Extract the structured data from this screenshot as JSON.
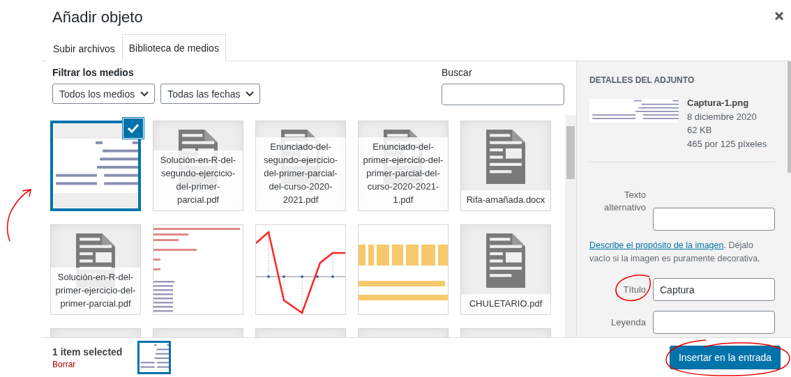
{
  "modal": {
    "title": "Añadir objeto"
  },
  "tabs": [
    {
      "label": "Subir archivos",
      "selected": false
    },
    {
      "label": "Biblioteca de medios",
      "selected": true
    }
  ],
  "filters": {
    "heading": "Filtrar los medios",
    "type_select": "Todos los medios",
    "date_select": "Todas las fechas"
  },
  "search": {
    "label": "Buscar"
  },
  "media": [
    {
      "kind": "table-image",
      "selected": true
    },
    {
      "kind": "document",
      "name": "Solución-en-R-del-segundo-ejercicio-del-primer-parcial.pdf",
      "selected": false
    },
    {
      "kind": "document",
      "name": "Enunciado-del-segundo-ejercicio-del-primer-parcial-del-curso-2020-2021.pdf",
      "selected": false
    },
    {
      "kind": "document",
      "name": "Enunciado-del-primer-ejercicio-del-primer-parcial-del-curso-2020-2021-1.pdf",
      "selected": false
    },
    {
      "kind": "document",
      "name": "Rifa-amañada.docx",
      "selected": false
    },
    {
      "kind": "document",
      "name": "Solución-en-R-del-primer-ejercicio-del-primer-parcial.pdf",
      "selected": false
    },
    {
      "kind": "code-image",
      "selected": false
    },
    {
      "kind": "graph-image",
      "selected": false
    },
    {
      "kind": "banner-image",
      "selected": false
    },
    {
      "kind": "document",
      "name": "CHULETARIO.pdf",
      "selected": false
    },
    {
      "kind": "blank",
      "selected": false
    },
    {
      "kind": "blank",
      "selected": false
    },
    {
      "kind": "blank",
      "selected": false
    },
    {
      "kind": "blank",
      "selected": false
    },
    {
      "kind": "blank",
      "selected": false
    }
  ],
  "details": {
    "heading": "DETALLES DEL ADJUNTO",
    "filename": "Captura-1.png",
    "date": "8 diciembre 2020",
    "size": "62 KB",
    "dimensions": "465 por 125 píxeles",
    "alt_label": "Texto alternativo",
    "alt_help_link": "Describe el propósito de la imagen",
    "alt_help": ". Déjalo vacío si la imagen es puramente decorativa.",
    "title_label": "Título",
    "title_value": "Captura",
    "caption_label": "Leyenda"
  },
  "toolbar": {
    "selection_count": "1 item selected",
    "clear_link": "Borrar",
    "insert_button": "Insertar en la entrada"
  }
}
